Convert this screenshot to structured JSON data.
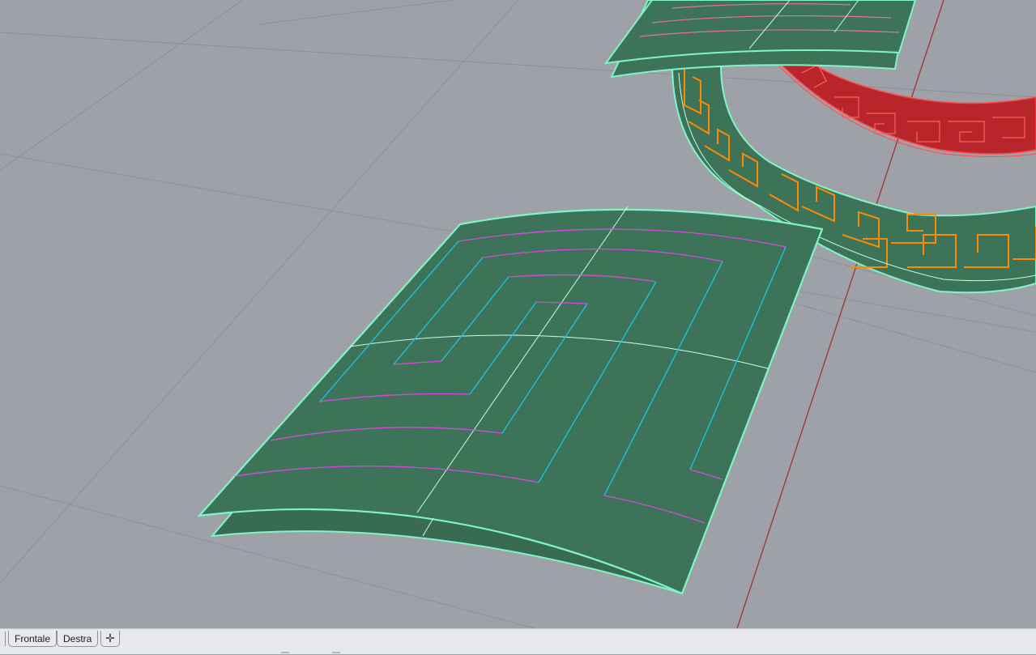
{
  "viewport": {
    "background": "#9ea2a8",
    "grid_color": "#8d9197",
    "surface_color": "#3d7358",
    "surface_edge_color": "#7ff5c6",
    "pattern_cyan": "#19c7e6",
    "pattern_magenta": "#d44bdc",
    "selected_orange": "#ff8a00",
    "ring_red": "#c8232a",
    "axis_red": "#9e3a3a"
  },
  "tabs": [
    {
      "label": "Frontale"
    },
    {
      "label": "Destra"
    }
  ],
  "add_tab_icon": "plus-icon"
}
